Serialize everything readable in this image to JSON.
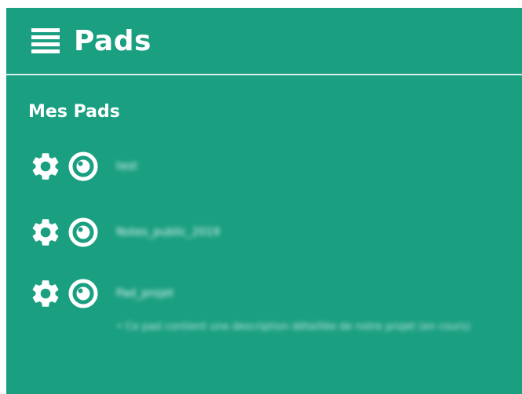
{
  "header": {
    "title": "Pads",
    "menu_icon": "hamburger-menu-icon"
  },
  "section": {
    "title": "Mes Pads"
  },
  "pads": [
    {
      "name": "test",
      "settings_icon": "gear-icon",
      "view_icon": "eye-icon"
    },
    {
      "name": "Notes_public_2019",
      "settings_icon": "gear-icon",
      "view_icon": "eye-icon"
    },
    {
      "name": "Pad_projet",
      "description": "• Ce pad contient une description détaillée de notre projet (en cours)",
      "settings_icon": "gear-icon",
      "view_icon": "eye-icon"
    }
  ],
  "colors": {
    "panel_background": "#1a9f81",
    "text": "#ffffff",
    "divider": "#d9efe8"
  }
}
